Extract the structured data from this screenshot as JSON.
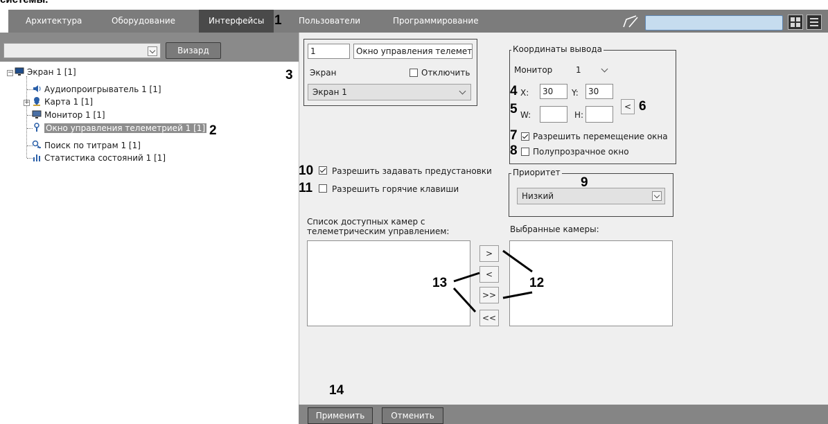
{
  "caption": "системы.",
  "nav": {
    "tabs": [
      "Архитектура",
      "Оборудование",
      "Интерфейсы",
      "Пользователи",
      "Программирование"
    ],
    "active_tab": "Интерфейсы"
  },
  "left": {
    "wizard_label": "Визард",
    "tree": [
      {
        "label": "Экран 1 [1]",
        "icon": "monitor-icon"
      },
      {
        "label": "Аудиопроигрыватель 1 [1]",
        "icon": "speaker-icon"
      },
      {
        "label": "Карта 1 [1]",
        "icon": "map-pin-icon"
      },
      {
        "label": "Монитор 1 [1]",
        "icon": "monitor-icon"
      },
      {
        "label": "Окно управления телеметрией 1 [1]",
        "icon": "telemetry-icon",
        "selected": true
      },
      {
        "label": "Поиск по титрам 1 [1]",
        "icon": "search-icon"
      },
      {
        "label": "Статистика состояний 1 [1]",
        "icon": "stats-icon"
      }
    ]
  },
  "form": {
    "id_value": "1",
    "name_value": "Окно управления телеметр",
    "screen_label": "Экран",
    "disable_label": "Отключить",
    "screen_select": "Экран 1",
    "coords": {
      "title": "Координаты вывода",
      "monitor_label": "Монитор",
      "monitor_value": "1",
      "x_label": "X:",
      "x_value": "30",
      "y_label": "Y:",
      "y_value": "30",
      "w_label": "W:",
      "w_value": "",
      "h_label": "H:",
      "h_value": "",
      "arrow_label": "<",
      "allow_move_label": "Разрешить перемещение окна",
      "allow_move_checked": true,
      "translucent_label": "Полупрозрачное окно",
      "translucent_checked": false
    },
    "allow_presets_label": "Разрешить задавать предустановки",
    "allow_presets_checked": true,
    "allow_hotkeys_label": "Разрешить горячие клавиши",
    "allow_hotkeys_checked": false,
    "priority": {
      "title": "Приоритет",
      "value": "Низкий"
    },
    "available_title": "Список доступных камер с телеметрическим управлением:",
    "selected_title": "Выбранные камеры:",
    "move_buttons": [
      ">",
      "<",
      ">>",
      "<<"
    ],
    "apply_label": "Применить",
    "cancel_label": "Отменить"
  },
  "callouts": {
    "n1": "1",
    "n2": "2",
    "n3": "3",
    "n4": "4",
    "n5": "5",
    "n6": "6",
    "n7": "7",
    "n8": "8",
    "n9": "9",
    "n10": "10",
    "n11": "11",
    "n12": "12",
    "n13": "13",
    "n14": "14"
  },
  "colors": {
    "topbar": "#7c7c7c",
    "active_tab": "#4a4a4a",
    "search": "#c6dcef",
    "panel": "#efefef"
  }
}
